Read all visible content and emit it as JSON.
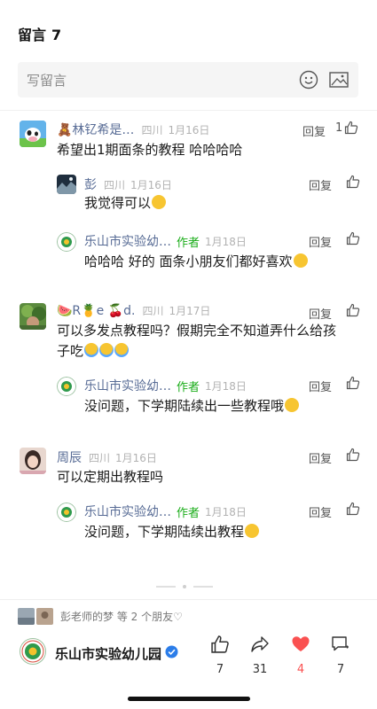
{
  "header": {
    "title": "留言",
    "count": "7"
  },
  "input": {
    "placeholder": "写留言"
  },
  "comments": [
    {
      "name": "🧸林钇希是…",
      "location": "四川",
      "date": "1月16日",
      "text": "希望出1期面条的教程 哈哈哈哈",
      "reply_label": "回复",
      "likes": "1",
      "replies": [
        {
          "name": "彭",
          "location": "四川",
          "date": "1月16日",
          "text": "我觉得可以",
          "reply_label": "回复"
        },
        {
          "name": "乐山市实验幼…",
          "author_tag": "作者",
          "date": "1月18日",
          "text": "哈哈哈 好的 面条小朋友们都好喜欢",
          "reply_label": "回复"
        }
      ]
    },
    {
      "name": "🍉R🍍e 🍒d.",
      "location": "四川",
      "date": "1月17日",
      "text_line1": "可以多发点教程吗？假期完全不知道弄什么给孩",
      "text_line2": "子吃",
      "reply_label": "回复",
      "replies": [
        {
          "name": "乐山市实验幼…",
          "author_tag": "作者",
          "date": "1月18日",
          "text": "没问题，下学期陆续出一些教程哦",
          "reply_label": "回复"
        }
      ]
    },
    {
      "name": "周辰",
      "location": "四川",
      "date": "1月16日",
      "text": "可以定期出教程吗",
      "reply_label": "回复",
      "replies": [
        {
          "name": "乐山市实验幼…",
          "author_tag": "作者",
          "date": "1月18日",
          "text": "没问题，下学期陆续出教程",
          "reply_label": "回复"
        }
      ]
    }
  ],
  "friends": {
    "text": "彭老师的梦 等 2 个朋友♡"
  },
  "footer": {
    "account": "乐山市实验幼儿园",
    "thumbs_count": "7",
    "share_count": "31",
    "heart_count": "4",
    "comment_count": "7"
  },
  "colors": {
    "accent_green": "#1aad19",
    "name_blue": "#576b95",
    "heart_red": "#fa5151",
    "verified_blue": "#2b7de9"
  }
}
